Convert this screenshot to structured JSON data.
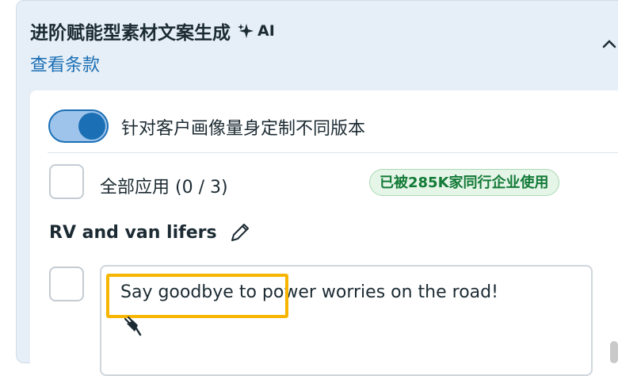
{
  "header": {
    "title": "进阶赋能型素材文案生成",
    "ai_badge": "AI",
    "terms_link": "查看条款"
  },
  "personalize": {
    "toggle_on": true,
    "label": "针对客户画像量身定制不同版本"
  },
  "apply_all": {
    "checked": false,
    "label": "全部应用 (0 / 3)"
  },
  "usage_badge": "已被285K家同行企业使用",
  "segment": {
    "title": "RV and van lifers",
    "copy_text": "Say goodbye to power worries on the road!",
    "checked": false
  },
  "colors": {
    "accent": "#1b6fb5",
    "badge_green": "#137a37",
    "highlight": "#f7b500"
  }
}
